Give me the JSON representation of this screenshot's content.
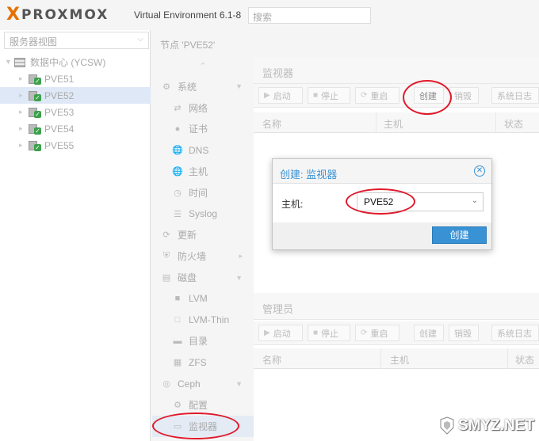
{
  "header": {
    "brand_word": "PROXMOX",
    "version": "Virtual Environment 6.1-8",
    "search_placeholder": "搜索"
  },
  "left_panel": {
    "view_selector": "服务器视图",
    "datacenter": "数据中心 (YCSW)",
    "nodes": [
      "PVE51",
      "PVE52",
      "PVE53",
      "PVE54",
      "PVE55"
    ],
    "selected_node": "PVE52"
  },
  "breadcrumb": "节点 'PVE52'",
  "node_nav": [
    {
      "label": "系统",
      "icon": "gear-icon",
      "level": 1,
      "expanded": true
    },
    {
      "label": "网络",
      "icon": "network-icon",
      "level": 2
    },
    {
      "label": "证书",
      "icon": "certificate-icon",
      "level": 2
    },
    {
      "label": "DNS",
      "icon": "globe-icon",
      "level": 2
    },
    {
      "label": "主机",
      "icon": "globe-icon",
      "level": 2
    },
    {
      "label": "时间",
      "icon": "clock-icon",
      "level": 2
    },
    {
      "label": "Syslog",
      "icon": "list-icon",
      "level": 2
    },
    {
      "label": "更新",
      "icon": "refresh-icon",
      "level": 1
    },
    {
      "label": "防火墙",
      "icon": "shield-icon",
      "level": 1,
      "collapsed": true
    },
    {
      "label": "磁盘",
      "icon": "hdd-icon",
      "level": 1,
      "expanded": true
    },
    {
      "label": "LVM",
      "icon": "square-icon",
      "level": 2
    },
    {
      "label": "LVM-Thin",
      "icon": "square-outline-icon",
      "level": 2
    },
    {
      "label": "目录",
      "icon": "folder-icon",
      "level": 2
    },
    {
      "label": "ZFS",
      "icon": "grid-icon",
      "level": 2
    },
    {
      "label": "Ceph",
      "icon": "ceph-icon",
      "level": 1,
      "expanded": true
    },
    {
      "label": "配置",
      "icon": "gear-icon",
      "level": 2
    },
    {
      "label": "监视器",
      "icon": "monitor-icon",
      "level": 2,
      "active": true
    }
  ],
  "monitor_panel": {
    "title": "监视器",
    "toolbar": {
      "start": "启动",
      "stop": "停止",
      "restart": "重启",
      "create": "创建",
      "destroy": "销毁",
      "syslog": "系统日志"
    },
    "columns": [
      "名称",
      "主机",
      "状态"
    ]
  },
  "manager_panel": {
    "title": "管理员",
    "toolbar": {
      "start": "启动",
      "stop": "停止",
      "restart": "重启",
      "create": "创建",
      "destroy": "销毁",
      "syslog": "系统日志"
    },
    "columns": [
      "名称",
      "主机",
      "状态"
    ]
  },
  "dialog": {
    "title": "创建: 监视器",
    "host_label": "主机:",
    "host_value": "PVE52",
    "submit": "创建"
  },
  "colors": {
    "accent": "#3892d4",
    "brand_orange": "#e57000",
    "annotation_red": "#e0192b"
  },
  "watermark": "SMYZ.NET"
}
